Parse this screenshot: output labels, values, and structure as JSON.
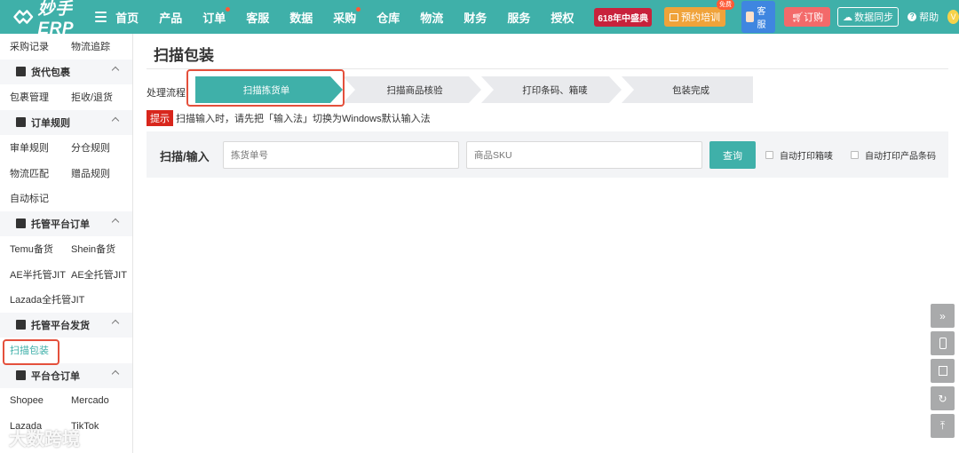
{
  "app": {
    "logo_text": "妙手ERP",
    "brand_color": "#3fb0a9"
  },
  "nav": {
    "items": [
      {
        "label": "首页",
        "dot": false
      },
      {
        "label": "产品",
        "dot": false
      },
      {
        "label": "订单",
        "dot": true
      },
      {
        "label": "客服",
        "dot": false
      },
      {
        "label": "数据",
        "dot": false
      },
      {
        "label": "采购",
        "dot": true
      },
      {
        "label": "仓库",
        "dot": false
      },
      {
        "label": "物流",
        "dot": false
      },
      {
        "label": "财务",
        "dot": false
      },
      {
        "label": "服务",
        "dot": false
      },
      {
        "label": "授权",
        "dot": false
      }
    ],
    "promo_badge": "618年中盛典",
    "training_label": "预约培训",
    "training_free_tag": "免费",
    "service_label": "客服",
    "order_label": "订购",
    "sync_label": "数据同步",
    "help_label": "帮助",
    "user_initial": "V"
  },
  "sidebar": {
    "top_row": [
      "采购记录",
      "物流追踪"
    ],
    "groups": [
      {
        "title": "货代包裹",
        "items": [
          [
            "包裹管理",
            "拒收/退货"
          ]
        ]
      },
      {
        "title": "订单规则",
        "items": [
          [
            "审单规则",
            "分仓规则"
          ],
          [
            "物流匹配",
            "赠品规则"
          ],
          [
            "自动标记",
            ""
          ]
        ]
      },
      {
        "title": "托管平台订单",
        "items": [
          [
            "Temu备货",
            "Shein备货"
          ],
          [
            "AE半托管JIT",
            "AE全托管JIT"
          ],
          [
            "Lazada全托管JIT",
            ""
          ]
        ]
      },
      {
        "title": "托管平台发货",
        "items": [
          [
            "扫描包装",
            ""
          ]
        ]
      },
      {
        "title": "平台仓订单",
        "items": [
          [
            "Shopee",
            "Mercado"
          ],
          [
            "Lazada",
            "TikTok"
          ]
        ]
      }
    ],
    "active_item": "扫描包装"
  },
  "main": {
    "title": "扫描包装",
    "flow_label": "处理流程:",
    "steps": [
      "扫描拣货单",
      "扫描商品核验",
      "打印条码、箱唛",
      "包装完成"
    ],
    "active_step": 0,
    "tip_tag": "提示",
    "tip_text": "扫描输入时，请先把「输入法」切换为Windows默认输入法",
    "scan_label": "扫描/输入",
    "picklist_placeholder": "拣货单号",
    "sku_placeholder": "商品SKU",
    "query_label": "查询",
    "check_box_label": "自动打印箱唛",
    "check_barcode_label": "自动打印产品条码"
  },
  "watermark": "大数跨境"
}
